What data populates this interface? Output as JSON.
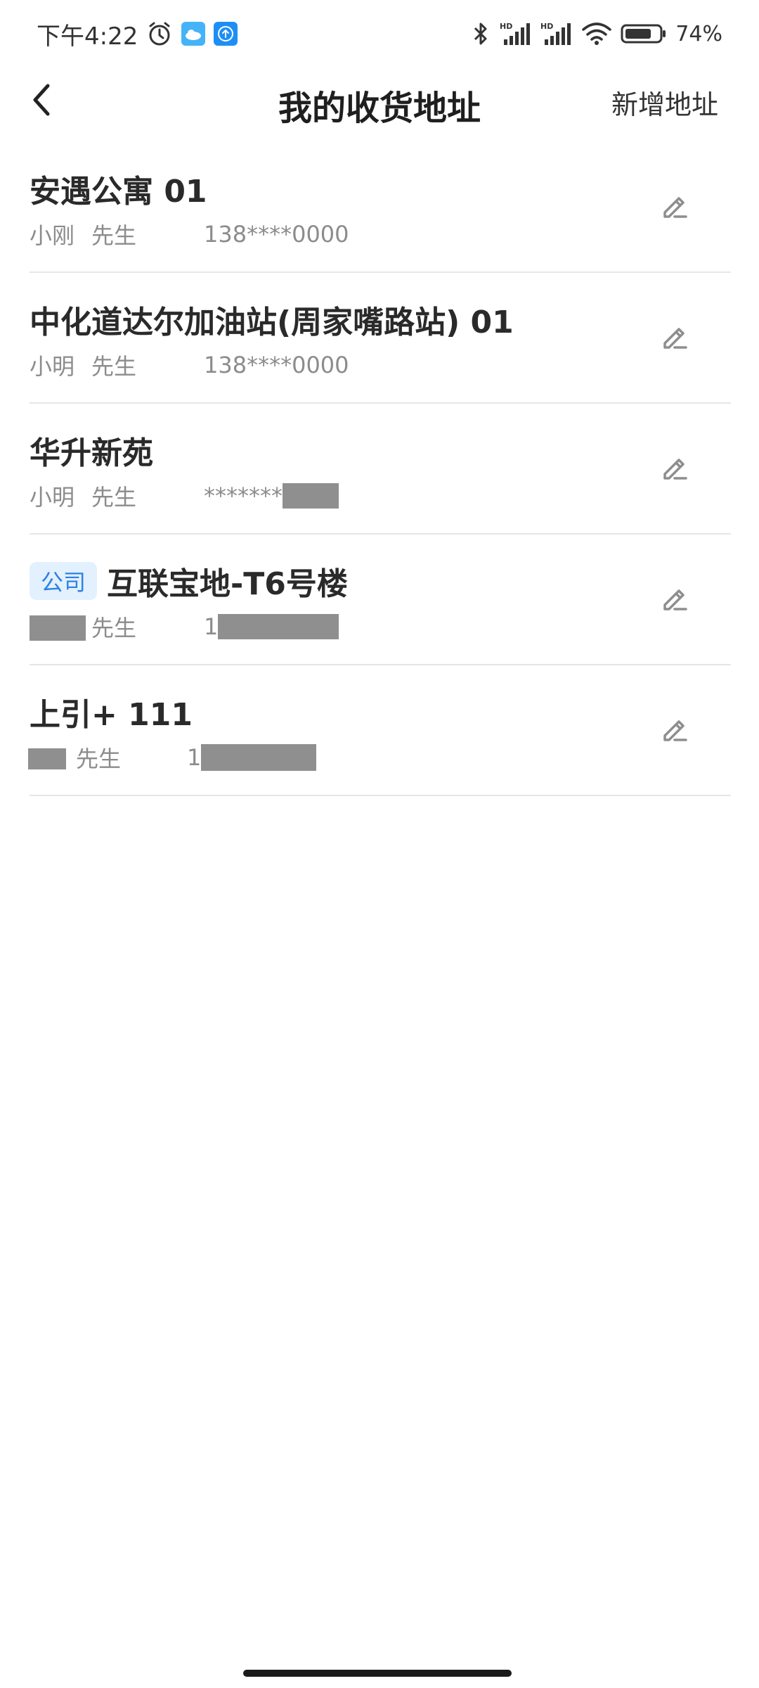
{
  "status_bar": {
    "time": "下午4:22",
    "icons": [
      "alarm-icon",
      "weather-app-icon",
      "upload-app-icon",
      "bluetooth-icon",
      "signal-hd-icon",
      "signal-hd-icon",
      "wifi-icon",
      "battery-icon"
    ],
    "battery": "74%"
  },
  "header": {
    "back_icon": "chevron-left-icon",
    "title": "我的收货地址",
    "add_label": "新增地址"
  },
  "addresses": [
    {
      "title": "安遇公寓 01",
      "tag": "",
      "name": "小刚",
      "honorific": "先生",
      "phone": "138****0000"
    },
    {
      "title": "中化道达尔加油站(周家嘴路站) 01",
      "tag": "",
      "name": "小明",
      "honorific": "先生",
      "phone": "138****0000"
    },
    {
      "title": "华升新苑",
      "tag": "",
      "name": "小明",
      "honorific": "先生",
      "phone": "*******"
    },
    {
      "title": "互联宝地-T6号楼",
      "tag": "公司",
      "name": "",
      "honorific": "先生",
      "phone": "1"
    },
    {
      "title": "上引+ 111",
      "tag": "",
      "name": "",
      "honorific": "先生",
      "phone": "1"
    }
  ],
  "colors": {
    "tag_bg": "#e3f0fd",
    "tag_text": "#2b82e6",
    "meta_text": "#8c8c8c",
    "divider": "#e6e6e6"
  }
}
